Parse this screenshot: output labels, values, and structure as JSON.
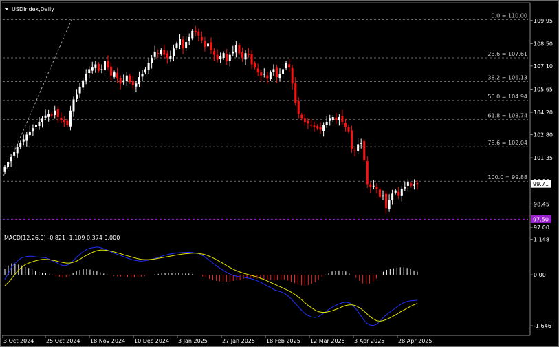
{
  "colors": {
    "background": "#000000",
    "candle_up": "#ffffff",
    "candle_down": "#ff1010",
    "grid": "#8a8a8a",
    "macd_line": "#2030ff",
    "signal_line": "#e6e600",
    "histogram_up": "#ffffff",
    "histogram_down": "#ff2020",
    "support_line": "#9a22cc",
    "price_badge": "#ffffff"
  },
  "icons": {
    "menu": "triangle-down-icon"
  },
  "chart_data": {
    "type": "candlestick",
    "title": "USDIndex,Daily",
    "symbol": "USDIndex",
    "timeframe": "Daily",
    "grid": false,
    "ylim": [
      97.0,
      110.5
    ],
    "y_ticks": [
      "109.95",
      "108.50",
      "107.10",
      "105.65",
      "104.20",
      "102.80",
      "101.35",
      "99.90",
      "98.45",
      "97.00"
    ],
    "x_ticks": [
      "3 Oct 2024",
      "25 Oct 2024",
      "18 Nov 2024",
      "10 Dec 2024",
      "3 Jan 2025",
      "27 Jan 2025",
      "18 Feb 2025",
      "12 Mar 2025",
      "3 Apr 2025",
      "28 Apr 2025"
    ],
    "current_price": "99.71",
    "support_level": "97.50",
    "fibonacci": [
      {
        "label": "0.0 = 110.00",
        "value": 110.0
      },
      {
        "label": "23.6 = 107.61",
        "value": 107.61
      },
      {
        "label": "38.2 = 106.13",
        "value": 106.13
      },
      {
        "label": "50.0 = 104.94",
        "value": 104.94
      },
      {
        "label": "61.8 = 103.74",
        "value": 103.74
      },
      {
        "label": "78.6 = 102.04",
        "value": 102.04
      },
      {
        "label": "100.0 = 99.88",
        "value": 99.88
      }
    ],
    "close_series": [
      100.8,
      101.1,
      101.4,
      101.7,
      102.0,
      102.3,
      102.5,
      102.8,
      103.0,
      103.2,
      103.4,
      103.6,
      103.8,
      104.0,
      104.1,
      104.0,
      104.3,
      103.9,
      103.7,
      103.6,
      103.4,
      104.3,
      105.0,
      105.3,
      105.8,
      106.2,
      106.6,
      106.9,
      107.0,
      107.2,
      106.8,
      106.9,
      107.4,
      107.0,
      106.5,
      106.7,
      106.3,
      106.0,
      106.2,
      106.5,
      106.1,
      105.9,
      106.0,
      106.4,
      106.6,
      106.9,
      107.3,
      107.6,
      108.0,
      107.9,
      108.1,
      107.8,
      107.6,
      107.7,
      108.2,
      108.5,
      108.8,
      108.2,
      108.6,
      108.9,
      109.3,
      109.2,
      109.0,
      108.7,
      108.3,
      108.5,
      108.1,
      107.8,
      107.5,
      107.7,
      107.9,
      107.4,
      107.8,
      108.0,
      108.4,
      107.9,
      107.6,
      107.9,
      107.8,
      107.2,
      107.0,
      106.7,
      106.5,
      106.6,
      106.3,
      106.7,
      106.9,
      106.4,
      106.6,
      106.9,
      107.3,
      107.0,
      106.0,
      104.8,
      104.1,
      103.8,
      103.6,
      103.5,
      103.4,
      103.3,
      103.2,
      103.1,
      103.4,
      103.6,
      103.8,
      103.9,
      103.7,
      103.9,
      103.6,
      103.3,
      103.0,
      101.9,
      101.8,
      102.2,
      102.3,
      101.2,
      99.7,
      99.5,
      99.6,
      99.4,
      98.9,
      99.0,
      98.2,
      98.7,
      99.1,
      99.3,
      99.0,
      99.4,
      99.5,
      99.8,
      99.6,
      99.7,
      99.71
    ],
    "macd": {
      "label": "MACD(12,26,9) -0.821 -1.109 0.374 0.000",
      "ylim": [
        -1.8,
        1.25
      ],
      "y_ticks": [
        "1.148",
        "0.00",
        "-1.646"
      ],
      "macd_series": [
        -0.15,
        0.05,
        0.25,
        0.38,
        0.48,
        0.55,
        0.58,
        0.6,
        0.6,
        0.58,
        0.57,
        0.56,
        0.55,
        0.5,
        0.45,
        0.4,
        0.35,
        0.3,
        0.3,
        0.35,
        0.45,
        0.56,
        0.66,
        0.75,
        0.82,
        0.86,
        0.88,
        0.9,
        0.88,
        0.84,
        0.8,
        0.75,
        0.7,
        0.66,
        0.62,
        0.58,
        0.54,
        0.5,
        0.47,
        0.45,
        0.44,
        0.45,
        0.47,
        0.5,
        0.53,
        0.56,
        0.6,
        0.63,
        0.66,
        0.68,
        0.7,
        0.71,
        0.72,
        0.72,
        0.73,
        0.72,
        0.7,
        0.68,
        0.62,
        0.55,
        0.47,
        0.38,
        0.3,
        0.22,
        0.15,
        0.08,
        0.02,
        -0.02,
        -0.05,
        -0.07,
        -0.08,
        -0.1,
        -0.12,
        -0.15,
        -0.19,
        -0.24,
        -0.3,
        -0.36,
        -0.42,
        -0.48,
        -0.52,
        -0.55,
        -0.6,
        -0.68,
        -0.78,
        -0.9,
        -1.02,
        -1.14,
        -1.25,
        -1.32,
        -1.36,
        -1.38,
        -1.35,
        -1.28,
        -1.2,
        -1.12,
        -1.05,
        -0.99,
        -0.94,
        -0.9,
        -0.88,
        -0.9,
        -0.98,
        -1.1,
        -1.25,
        -1.42,
        -1.55,
        -1.62,
        -1.64,
        -1.6,
        -1.5,
        -1.38,
        -1.28,
        -1.2,
        -1.12,
        -1.04,
        -0.96,
        -0.9,
        -0.86,
        -0.84,
        -0.83,
        -0.82
      ],
      "signal_series": [
        -0.35,
        -0.25,
        -0.12,
        0.02,
        0.15,
        0.25,
        0.33,
        0.38,
        0.42,
        0.45,
        0.48,
        0.5,
        0.5,
        0.49,
        0.47,
        0.45,
        0.42,
        0.4,
        0.38,
        0.38,
        0.4,
        0.44,
        0.5,
        0.57,
        0.63,
        0.69,
        0.74,
        0.78,
        0.8,
        0.8,
        0.79,
        0.77,
        0.74,
        0.71,
        0.68,
        0.64,
        0.61,
        0.58,
        0.55,
        0.52,
        0.5,
        0.49,
        0.49,
        0.5,
        0.51,
        0.53,
        0.55,
        0.57,
        0.59,
        0.61,
        0.63,
        0.65,
        0.67,
        0.68,
        0.69,
        0.7,
        0.7,
        0.69,
        0.67,
        0.64,
        0.6,
        0.55,
        0.49,
        0.43,
        0.37,
        0.3,
        0.24,
        0.18,
        0.13,
        0.09,
        0.05,
        0.02,
        -0.01,
        -0.04,
        -0.07,
        -0.11,
        -0.15,
        -0.2,
        -0.25,
        -0.3,
        -0.35,
        -0.4,
        -0.45,
        -0.5,
        -0.56,
        -0.63,
        -0.71,
        -0.8,
        -0.9,
        -0.99,
        -1.07,
        -1.14,
        -1.19,
        -1.21,
        -1.21,
        -1.19,
        -1.16,
        -1.12,
        -1.08,
        -1.03,
        -0.99,
        -0.97,
        -0.97,
        -1.0,
        -1.06,
        -1.14,
        -1.24,
        -1.34,
        -1.42,
        -1.48,
        -1.5,
        -1.48,
        -1.44,
        -1.39,
        -1.33,
        -1.27,
        -1.2,
        -1.14,
        -1.08,
        -1.02,
        -0.97,
        -0.92
      ],
      "histogram": [
        0.2,
        0.3,
        0.37,
        0.36,
        0.33,
        0.3,
        0.25,
        0.22,
        0.18,
        0.13,
        0.09,
        0.06,
        0.05,
        0.01,
        -0.02,
        -0.05,
        -0.07,
        -0.1,
        -0.08,
        -0.03,
        0.05,
        0.12,
        0.16,
        0.18,
        0.19,
        0.17,
        0.14,
        0.12,
        0.08,
        0.04,
        0.01,
        -0.02,
        -0.04,
        -0.05,
        -0.06,
        -0.06,
        -0.07,
        -0.08,
        -0.08,
        -0.07,
        -0.06,
        -0.04,
        -0.02,
        0.0,
        0.02,
        0.03,
        0.05,
        0.06,
        0.07,
        0.07,
        0.07,
        0.06,
        0.05,
        0.04,
        0.04,
        0.02,
        0.0,
        -0.01,
        -0.05,
        -0.09,
        -0.13,
        -0.17,
        -0.19,
        -0.21,
        -0.22,
        -0.22,
        -0.22,
        -0.2,
        -0.18,
        -0.16,
        -0.13,
        -0.12,
        -0.11,
        -0.11,
        -0.12,
        -0.13,
        -0.15,
        -0.16,
        -0.17,
        -0.18,
        -0.17,
        -0.15,
        -0.15,
        -0.18,
        -0.22,
        -0.27,
        -0.31,
        -0.34,
        -0.35,
        -0.33,
        -0.29,
        -0.24,
        -0.16,
        -0.07,
        0.01,
        0.07,
        0.11,
        0.13,
        0.14,
        0.13,
        0.11,
        0.07,
        -0.01,
        -0.1,
        -0.19,
        -0.28,
        -0.31,
        -0.28,
        -0.22,
        -0.12,
        -0.01,
        0.1,
        0.16,
        0.19,
        0.21,
        0.23,
        0.24,
        0.24,
        0.22,
        0.18,
        0.14,
        0.1
      ]
    }
  }
}
